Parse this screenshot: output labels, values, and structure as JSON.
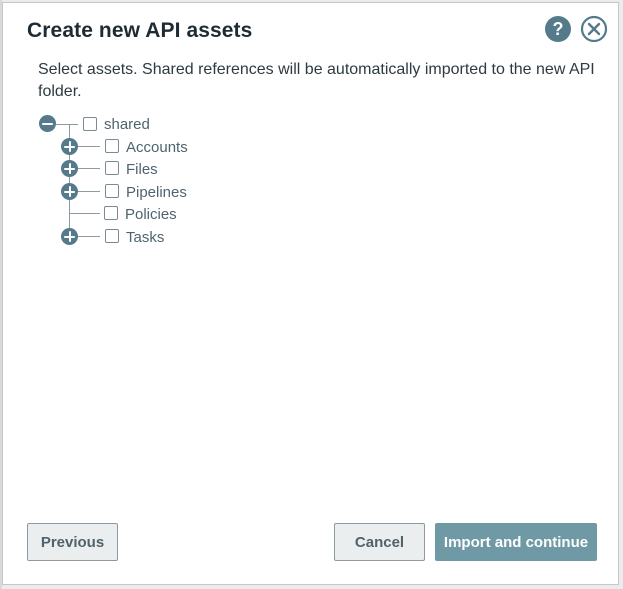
{
  "dialog": {
    "title": "Create new API assets",
    "instructions": "Select assets. Shared references will be automatically imported to the new API folder."
  },
  "icons": {
    "help": "help-circle-icon",
    "close": "close-circle-icon"
  },
  "tree": {
    "root": {
      "label": "shared",
      "expanded": true,
      "checked": false
    },
    "children": [
      {
        "label": "Accounts",
        "expandable": true,
        "checked": false
      },
      {
        "label": "Files",
        "expandable": true,
        "checked": false
      },
      {
        "label": "Pipelines",
        "expandable": true,
        "checked": false
      },
      {
        "label": "Policies",
        "expandable": false,
        "checked": false
      },
      {
        "label": "Tasks",
        "expandable": true,
        "checked": false
      }
    ]
  },
  "footer": {
    "previous_label": "Previous",
    "cancel_label": "Cancel",
    "import_label": "Import and continue"
  },
  "colors": {
    "accent": "#557a8b",
    "primary_button": "#6f9aa5",
    "text": "#1f2b33"
  }
}
